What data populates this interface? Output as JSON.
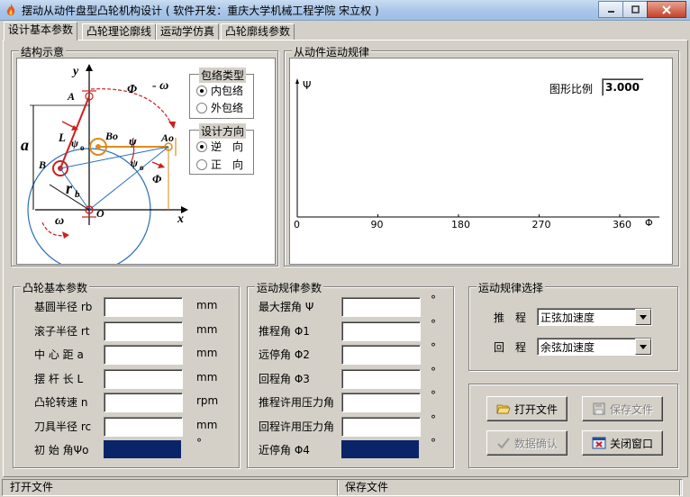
{
  "window": {
    "title": "摆动从动件盘型凸轮机构设计 ( 软件开发：重庆大学机械工程学院 宋立权 )"
  },
  "tabs": [
    "设计基本参数",
    "凸轮理论廓线",
    "运动学仿真",
    "凸轮廓线参数"
  ],
  "structure": {
    "title": "结构示意",
    "labels": {
      "y": "y",
      "x": "x",
      "A": "A",
      "B": "B",
      "Bo": "Bo",
      "Ao": "Ao",
      "O": "O",
      "L": "L",
      "a": "a",
      "rb": "r",
      "rb_sub": "b",
      "psi": "ψ",
      "psi0": "ψ",
      "psi0_sub": "o",
      "phi": "Φ",
      "omega_top": "- ω",
      "omega_bottom": "ω"
    },
    "envelope": {
      "title": "包络类型",
      "options": [
        "内包络",
        "外包络"
      ],
      "selected": 0
    },
    "direction": {
      "title": "设计方向",
      "options": [
        "逆　向",
        "正　向"
      ],
      "selected": 0
    }
  },
  "motion_chart": {
    "title": "从动件运动规律",
    "scale_label": "图形比例",
    "scale_value": "3.000",
    "y_axis_label": "Ψ",
    "x_axis_label": "Φ",
    "x_ticks": [
      "0",
      "90",
      "180",
      "270",
      "360"
    ]
  },
  "chart_data": {
    "type": "line",
    "x": [],
    "series": [],
    "xlabel": "Φ",
    "ylabel": "Ψ",
    "xlim": [
      0,
      360
    ],
    "x_ticks": [
      0,
      90,
      180,
      270,
      360
    ],
    "grid": false
  },
  "cam_params": {
    "title": "凸轮基本参数",
    "rows": [
      {
        "label": "基圆半径 rb",
        "unit": "mm",
        "value": ""
      },
      {
        "label": "滚子半径 rt",
        "unit": "mm",
        "value": ""
      },
      {
        "label": "中 心 距 a",
        "unit": "mm",
        "value": ""
      },
      {
        "label": "摆 杆 长 L",
        "unit": "mm",
        "value": ""
      },
      {
        "label": "凸轮转速 n",
        "unit": "rpm",
        "value": ""
      },
      {
        "label": "刀具半径 rc",
        "unit": "mm",
        "value": ""
      },
      {
        "label": "初 始 角Ψo",
        "unit": "°",
        "value": ""
      }
    ]
  },
  "motion_params": {
    "title": "运动规律参数",
    "rows": [
      {
        "label": "最大摆角 Ψ",
        "unit": "°",
        "value": ""
      },
      {
        "label": "推程角 Φ1",
        "unit": "°",
        "value": ""
      },
      {
        "label": "远停角 Φ2",
        "unit": "°",
        "value": ""
      },
      {
        "label": "回程角 Φ3",
        "unit": "°",
        "value": ""
      },
      {
        "label": "推程许用压力角",
        "unit": "°",
        "value": ""
      },
      {
        "label": "回程许用压力角",
        "unit": "°",
        "value": ""
      },
      {
        "label": "近停角 Φ4",
        "unit": "°",
        "value": ""
      }
    ]
  },
  "motion_select": {
    "title": "运动规律选择",
    "push_label": "推　程",
    "push_value": "正弦加速度",
    "return_label": "回　程",
    "return_value": "余弦加速度"
  },
  "buttons": {
    "open": "打开文件",
    "save": "保存文件",
    "confirm": "数据确认",
    "close": "关闭窗口"
  },
  "status": {
    "left": "打开文件",
    "middle": "保存文件"
  },
  "colors": {
    "accent": "#0a246a",
    "diagram_red": "#cc1f1f",
    "diagram_orange": "#e08a1e",
    "diagram_blue": "#2a6fb5"
  }
}
